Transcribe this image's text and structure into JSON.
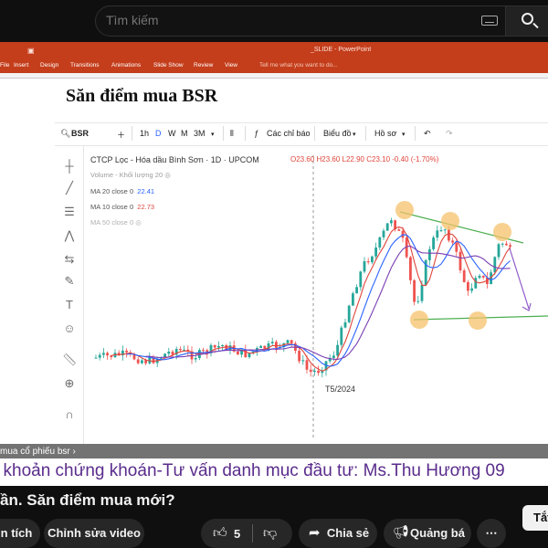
{
  "search": {
    "placeholder": "Tìm kiếm"
  },
  "ppt": {
    "window_title": "_SLIDE - PowerPoint",
    "tabs": [
      "File",
      "Insert",
      "Design",
      "Transitions",
      "Animations",
      "Slide Show",
      "Review",
      "View"
    ],
    "tell_me": "Tell me what you want to do...",
    "slide_title": "Săn điểm mua BSR"
  },
  "chart_toolbar": {
    "symbol": "BSR",
    "intervals": [
      "1h",
      "D",
      "W",
      "M",
      "3M"
    ],
    "indicators": "Các chỉ báo",
    "chart_type": "Biểu đồ",
    "profile": "Hồ sơ"
  },
  "chart_data": {
    "type": "candlestick",
    "title": "CTCP Lọc - Hóa dầu Bình Sơn · 1D · UPCOM",
    "ohlc": {
      "open": "O23.60",
      "high": "H23.60",
      "low": "L22.90",
      "close": "C23.10",
      "change": "-0.40 (-1.70%)"
    },
    "legend": [
      {
        "label": "Volume - Khối lượng 20",
        "value": "",
        "color": "#9b9b9b"
      },
      {
        "label": "MA 20 close 0",
        "value": "22.41",
        "color": "#2962ff"
      },
      {
        "label": "MA 10 close 0",
        "value": "22.73",
        "color": "#e0453b"
      },
      {
        "label": "MA 50 close 0",
        "value": "",
        "color": "#b0b0b0"
      }
    ],
    "annotation": "T5/2024",
    "colors": {
      "up": "#26a69a",
      "down": "#ef5350",
      "ma10": "#e0453b",
      "ma20": "#2962ff",
      "ma50": "#7b3fb5",
      "trend": "#4caf50",
      "highlight": "#f6c26b"
    }
  },
  "overlay": {
    "breadcrumb": "mua cổ phiếu bsr",
    "ticker": "i khoản chứng khoán-Tư vấn danh mục đầu tư: Ms.Thu Hương 09"
  },
  "video": {
    "title": "ần. Săn điểm mua mới?",
    "like_count": "5",
    "share": "Chia sẻ",
    "promote": "Quảng bá",
    "analytics": "n tích",
    "edit_video": "Chỉnh sửa video",
    "close_button": "Tắt"
  }
}
